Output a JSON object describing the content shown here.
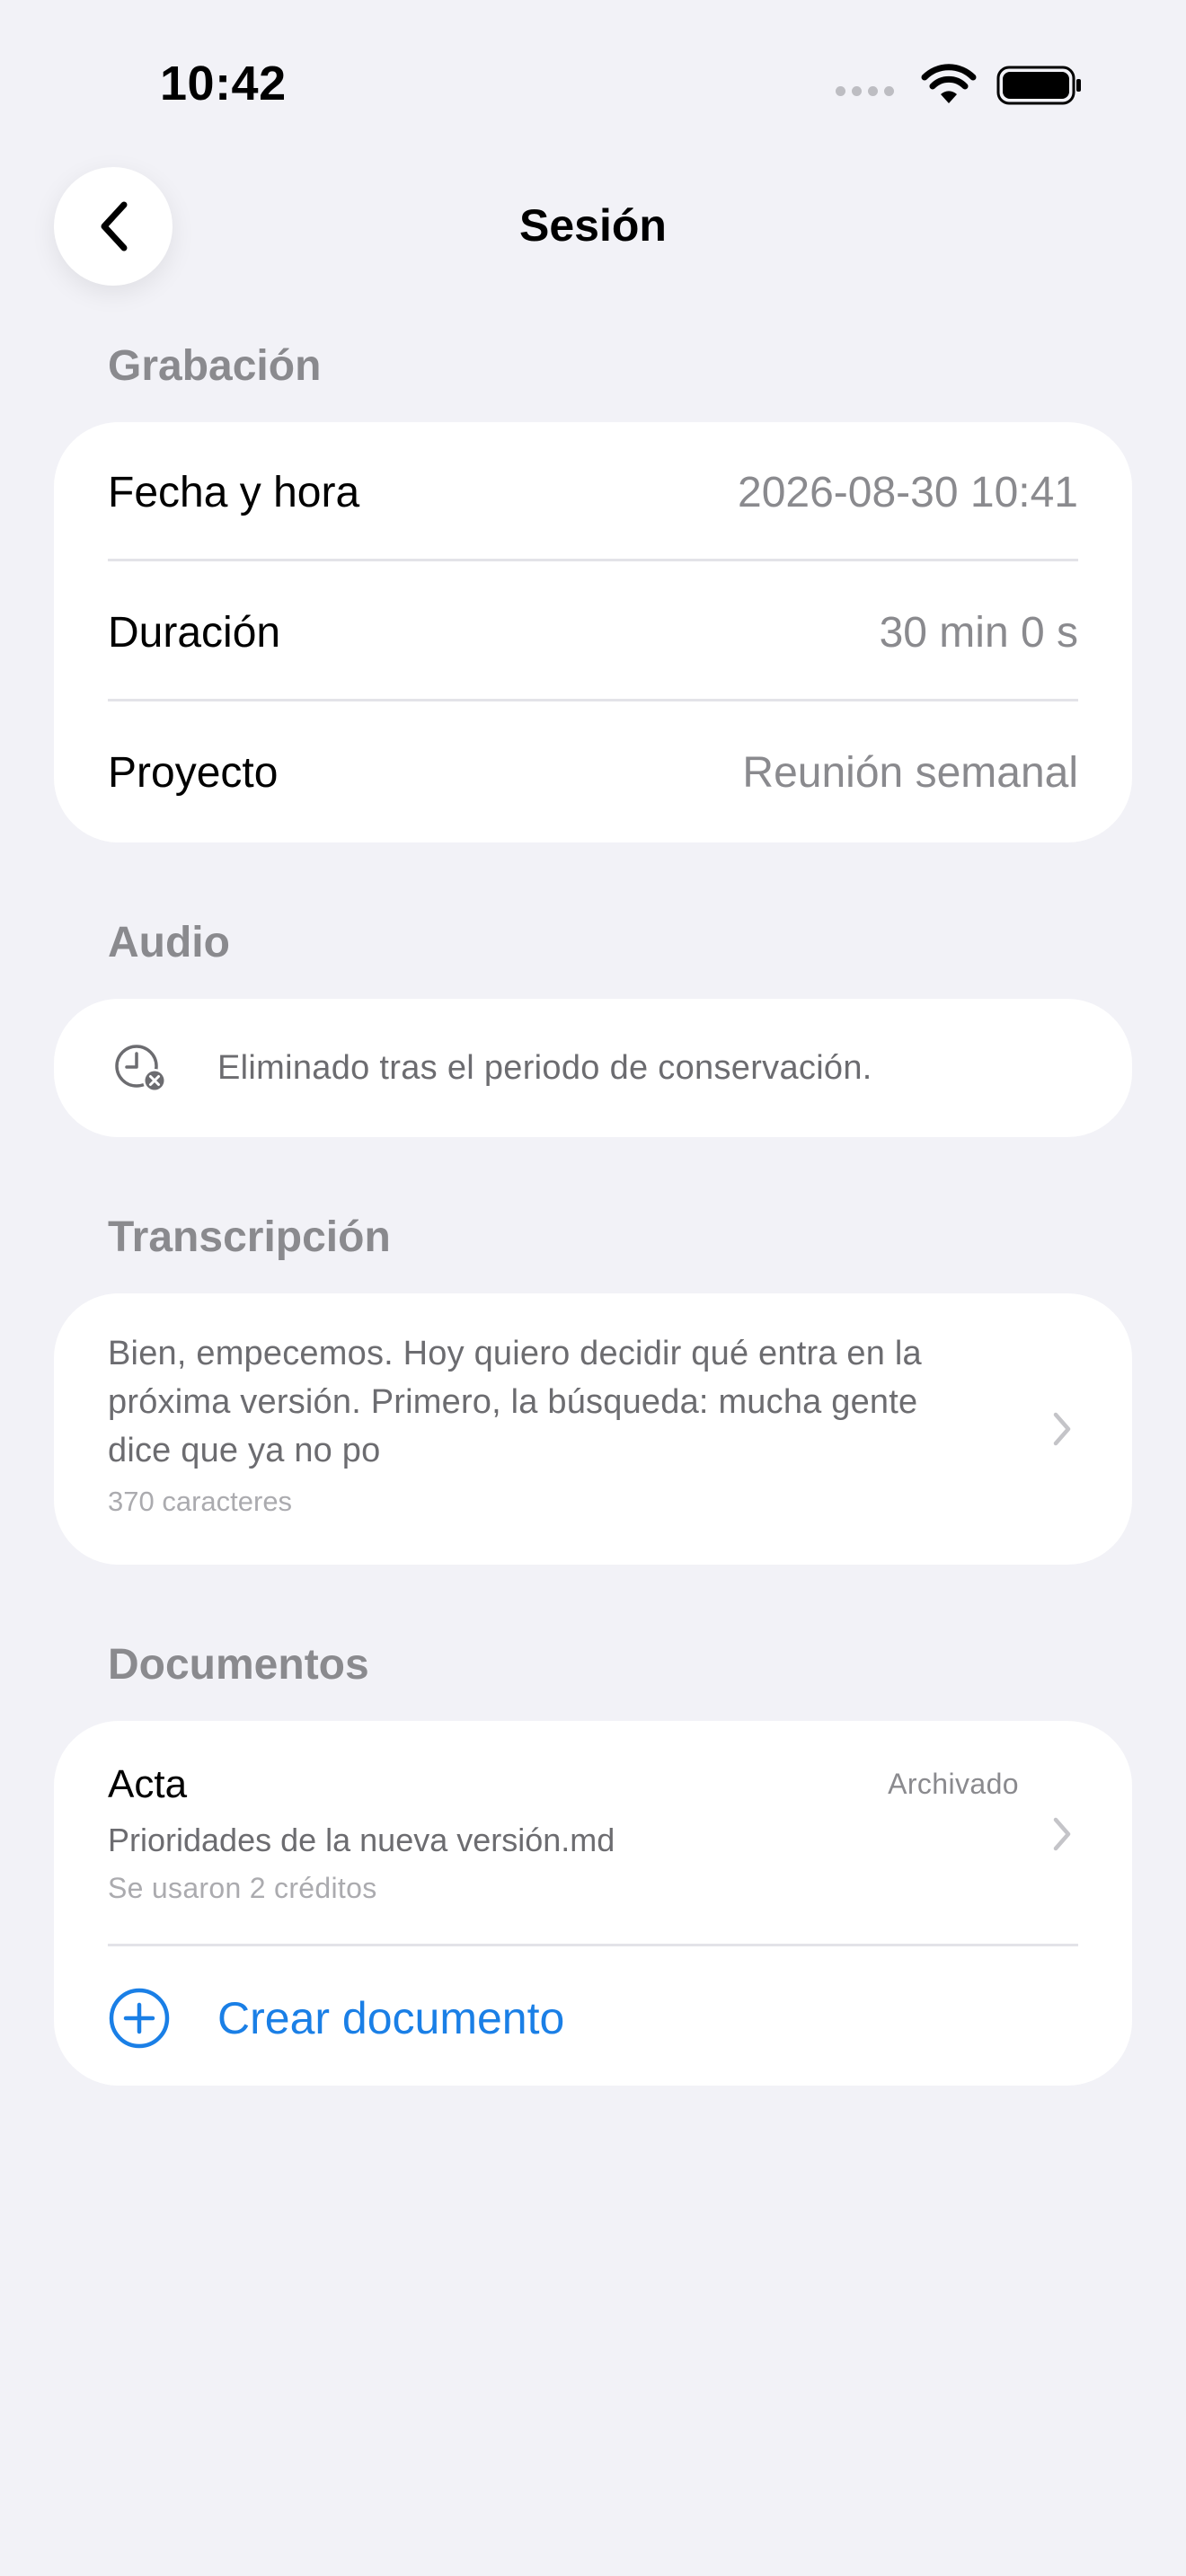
{
  "status_bar": {
    "time": "10:42"
  },
  "nav": {
    "title": "Sesión"
  },
  "recording": {
    "section_title": "Grabación",
    "rows": [
      {
        "label": "Fecha y hora",
        "value": "2026-08-30 10:41"
      },
      {
        "label": "Duración",
        "value": "30 min 0 s"
      },
      {
        "label": "Proyecto",
        "value": "Reunión semanal"
      }
    ]
  },
  "audio": {
    "section_title": "Audio",
    "icon": "clock-removed-icon",
    "message": "Eliminado tras el periodo de conservación."
  },
  "transcription": {
    "section_title": "Transcripción",
    "preview_line_1": "Bien, empecemos. Hoy quiero decidir qué entra en la",
    "preview_line_2": "próxima versión. Primero, la búsqueda: mucha gente",
    "preview_line_3": "dice que ya no po",
    "char_count": "370 caracteres"
  },
  "documents": {
    "section_title": "Documentos",
    "items": [
      {
        "name": "Acta",
        "status": "Archivado",
        "file": "Prioridades de la nueva versión.md",
        "credits": "Se usaron 2 créditos"
      }
    ],
    "create_label": "Crear documento"
  },
  "colors": {
    "background": "#F2F2F7",
    "card": "#FFFFFF",
    "accent": "#1A7FE6",
    "secondary_text": "#8A8A8E"
  }
}
